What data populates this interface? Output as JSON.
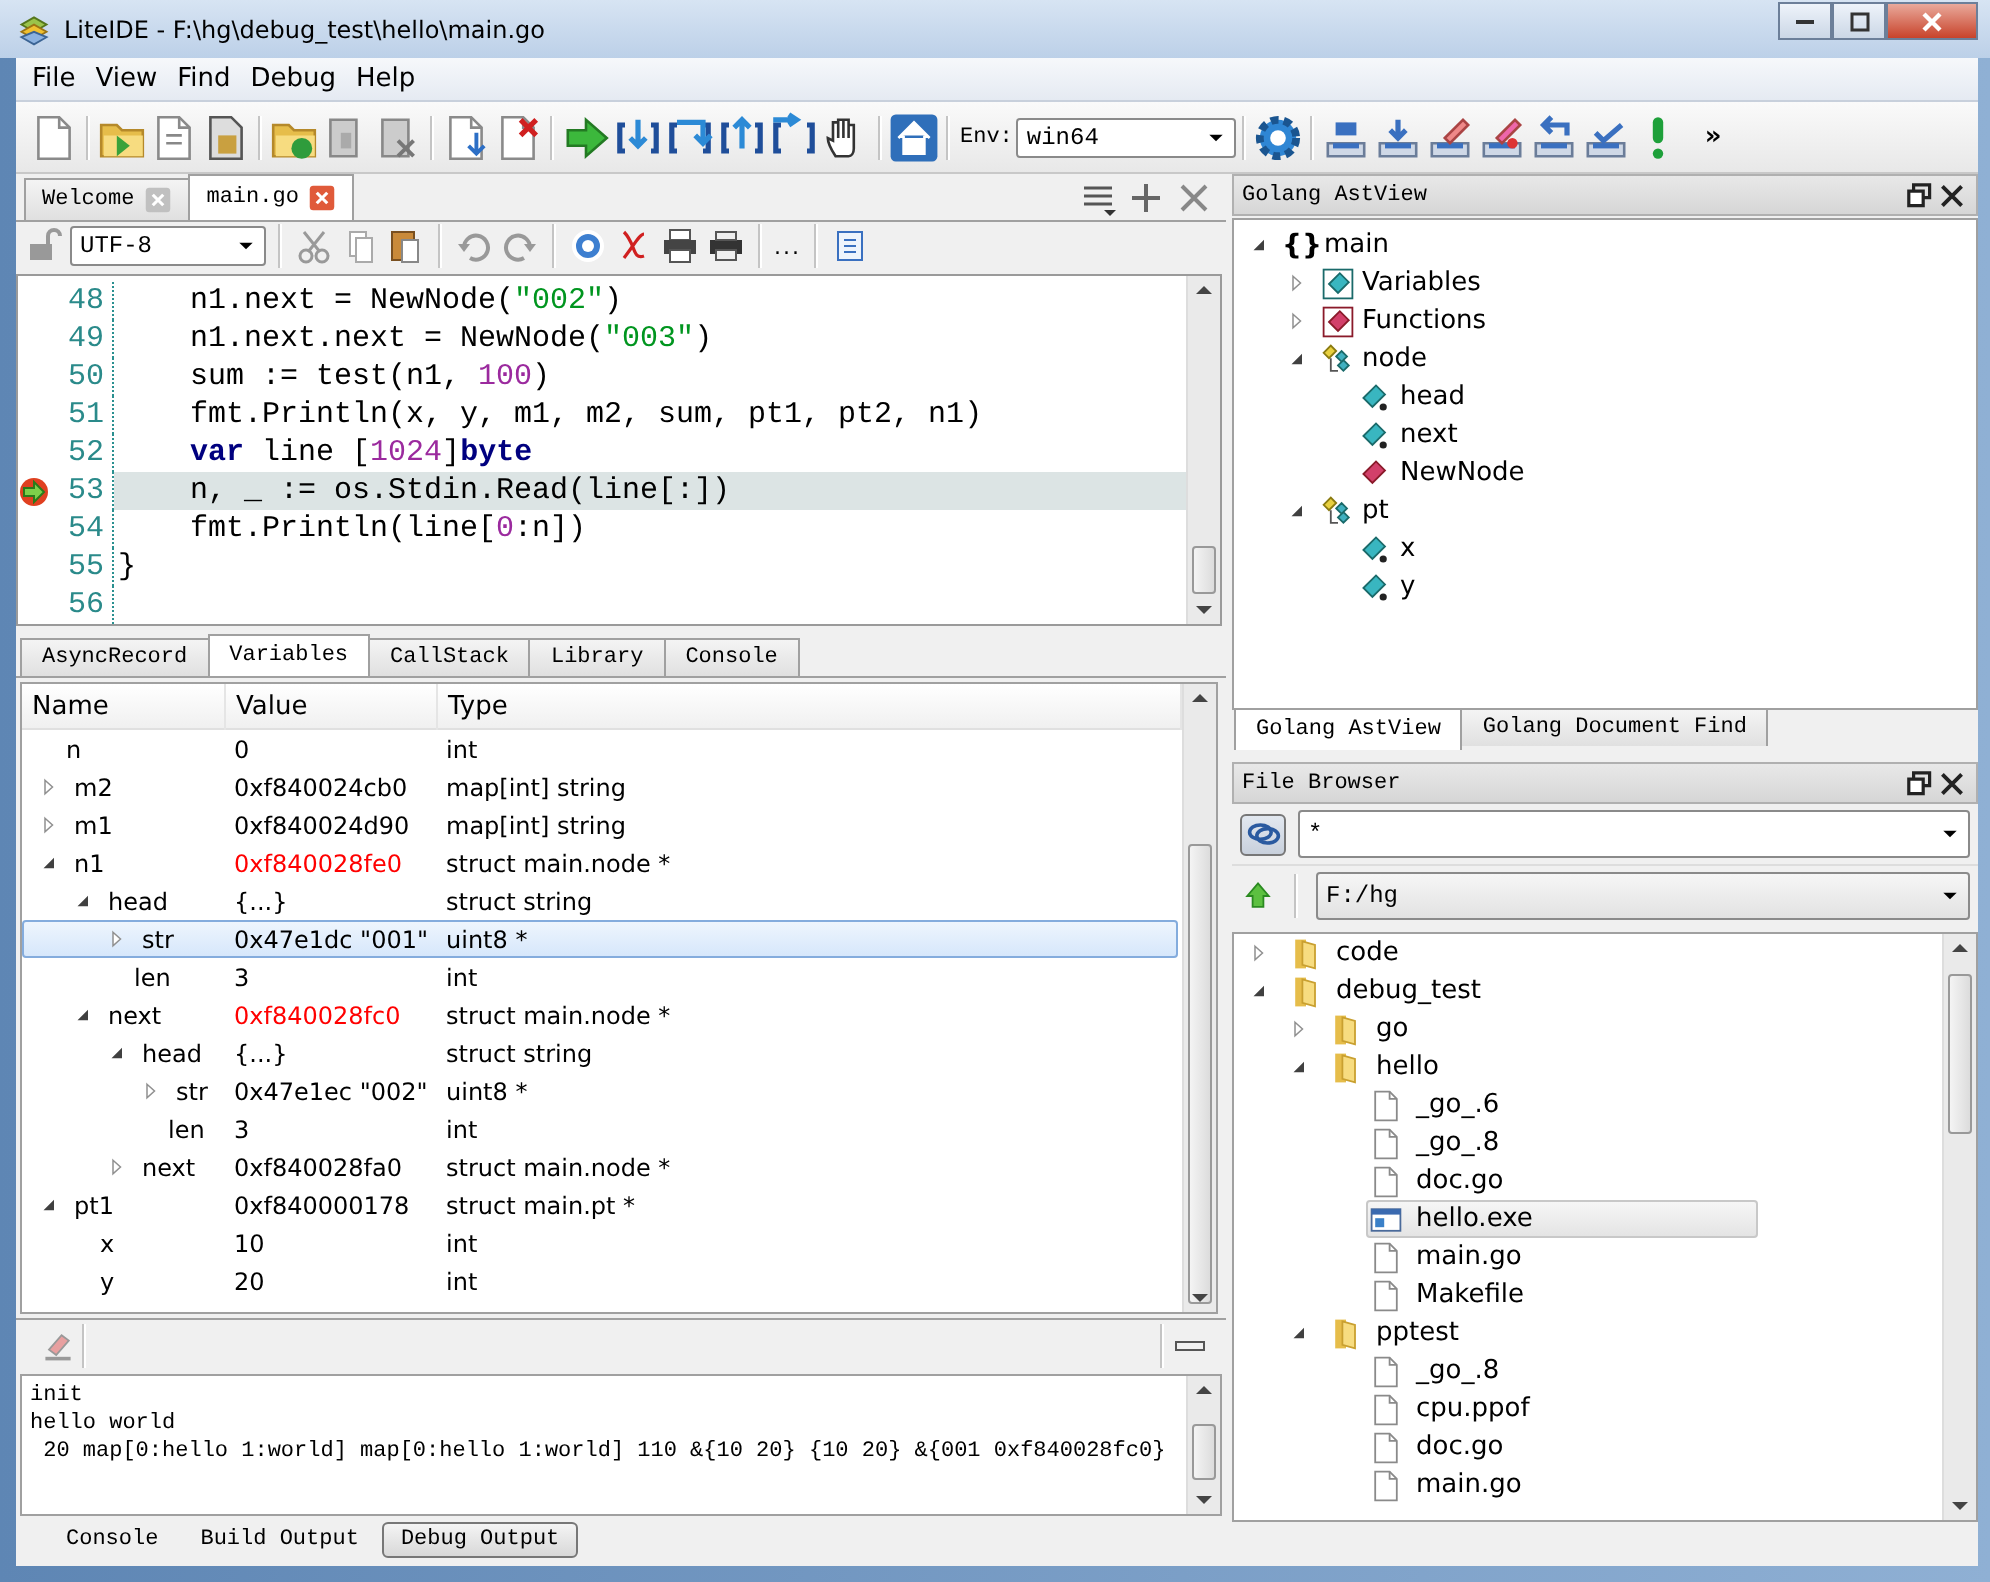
{
  "window": {
    "title": "LiteIDE - F:\\hg\\debug_test\\hello\\main.go"
  },
  "menu": [
    "File",
    "View",
    "Find",
    "Debug",
    "Help"
  ],
  "toolbar": {
    "env_label": "Env:",
    "env_value": "win64",
    "overflow": "»"
  },
  "editor": {
    "tabs": [
      {
        "label": "Welcome",
        "selected": false
      },
      {
        "label": "main.go",
        "selected": true
      }
    ],
    "encoding": "UTF-8",
    "more": "...",
    "lines": [
      {
        "number": "48",
        "current": false,
        "indented": true,
        "tokens": [
          {
            "kind": "plain",
            "text": "n1.next = NewNode("
          },
          {
            "kind": "string",
            "text": "\"002\""
          },
          {
            "kind": "plain",
            "text": ")"
          }
        ]
      },
      {
        "number": "49",
        "current": false,
        "indented": true,
        "tokens": [
          {
            "kind": "plain",
            "text": "n1.next.next = NewNode("
          },
          {
            "kind": "string",
            "text": "\"003\""
          },
          {
            "kind": "plain",
            "text": ")"
          }
        ]
      },
      {
        "number": "50",
        "current": false,
        "indented": true,
        "tokens": [
          {
            "kind": "plain",
            "text": "sum := test(n1, "
          },
          {
            "kind": "number",
            "text": "100"
          },
          {
            "kind": "plain",
            "text": ")"
          }
        ]
      },
      {
        "number": "51",
        "current": false,
        "indented": true,
        "tokens": [
          {
            "kind": "plain",
            "text": "fmt.Println(x, y, m1, m2, sum, pt1, pt2, n1)"
          }
        ]
      },
      {
        "number": "52",
        "current": false,
        "indented": true,
        "tokens": [
          {
            "kind": "keyword",
            "text": "var"
          },
          {
            "kind": "plain",
            "text": " line ["
          },
          {
            "kind": "number",
            "text": "1024"
          },
          {
            "kind": "plain",
            "text": "]"
          },
          {
            "kind": "keyword",
            "text": "byte"
          }
        ]
      },
      {
        "number": "53",
        "current": true,
        "indented": true,
        "tokens": [
          {
            "kind": "plain",
            "text": "n, _ := os.Stdin.Read(line[:])"
          }
        ]
      },
      {
        "number": "54",
        "current": false,
        "indented": true,
        "tokens": [
          {
            "kind": "plain",
            "text": "fmt.Println(line["
          },
          {
            "kind": "number",
            "text": "0"
          },
          {
            "kind": "plain",
            "text": ":n])"
          }
        ]
      },
      {
        "number": "55",
        "current": false,
        "indented": false,
        "tokens": [
          {
            "kind": "plain",
            "text": "}"
          }
        ]
      },
      {
        "number": "56",
        "current": false
      }
    ]
  },
  "debug": {
    "tabs": [
      {
        "label": "AsyncRecord",
        "selected": false
      },
      {
        "label": "Variables",
        "selected": true
      },
      {
        "label": "CallStack",
        "selected": false
      },
      {
        "label": "Library",
        "selected": false
      },
      {
        "label": "Console",
        "selected": false
      }
    ],
    "columns": [
      "Name",
      "Value",
      "Type"
    ],
    "rows": [
      {
        "name": "n",
        "value": "0",
        "type": "int",
        "changed": false,
        "selected": false
      },
      {
        "name": "m2",
        "value": "0xf840024cb0",
        "type": "map[int] string",
        "changed": false,
        "selected": false,
        "expanded": false
      },
      {
        "name": "m1",
        "value": "0xf840024d90",
        "type": "map[int] string",
        "changed": false,
        "selected": false,
        "expanded": false
      },
      {
        "name": "n1",
        "value": "0xf840028fe0",
        "type": "struct main.node *",
        "changed": true,
        "selected": false,
        "expanded": true,
        "children": [
          {
            "name": "head",
            "value": "{...}",
            "type": "struct string",
            "changed": false,
            "selected": false,
            "expanded": true,
            "children": [
              {
                "name": "str",
                "value": "0x47e1dc \"001\"",
                "type": "uint8 *",
                "changed": false,
                "selected": true,
                "expanded": false
              },
              {
                "name": "len",
                "value": "3",
                "type": "int",
                "changed": false,
                "selected": false
              }
            ]
          },
          {
            "name": "next",
            "value": "0xf840028fc0",
            "type": "struct main.node *",
            "changed": true,
            "selected": false,
            "expanded": true,
            "children": [
              {
                "name": "head",
                "value": "{...}",
                "type": "struct string",
                "changed": false,
                "selected": false,
                "expanded": true,
                "children": [
                  {
                    "name": "str",
                    "value": "0x47e1ec \"002\"",
                    "type": "uint8 *",
                    "changed": false,
                    "selected": false,
                    "expanded": false
                  },
                  {
                    "name": "len",
                    "value": "3",
                    "type": "int",
                    "changed": false,
                    "selected": false
                  }
                ]
              },
              {
                "name": "next",
                "value": "0xf840028fa0",
                "type": "struct main.node *",
                "changed": false,
                "selected": false,
                "expanded": false
              }
            ]
          }
        ]
      },
      {
        "name": "pt1",
        "value": "0xf840000178",
        "type": "struct main.pt *",
        "changed": false,
        "selected": false,
        "expanded": true,
        "children": [
          {
            "name": "x",
            "value": "10",
            "type": "int",
            "changed": false,
            "selected": false
          },
          {
            "name": "y",
            "value": "20",
            "type": "int",
            "changed": false,
            "selected": false
          }
        ]
      }
    ]
  },
  "output": {
    "lines": [
      "init",
      "hello world",
      " 20 map[0:hello 1:world] map[0:hello 1:world] 110 &{10 20} {10 20} &{001 0xf840028fc0}"
    ],
    "tabs": [
      {
        "label": "Console",
        "selected": false
      },
      {
        "label": "Build Output",
        "selected": false
      },
      {
        "label": "Debug Output",
        "selected": true
      }
    ]
  },
  "astview": {
    "title": "Golang AstView",
    "tree": [
      {
        "label": "main",
        "kind": "package",
        "icon": "{}",
        "expanded": true,
        "children": [
          {
            "label": "Variables",
            "kind": "vars",
            "expanded": false
          },
          {
            "label": "Functions",
            "kind": "funcs",
            "expanded": false
          },
          {
            "label": "node",
            "kind": "type",
            "expanded": true,
            "children": [
              {
                "label": "head",
                "kind": "field"
              },
              {
                "label": "next",
                "kind": "field"
              },
              {
                "label": "NewNode",
                "kind": "method"
              }
            ]
          },
          {
            "label": "pt",
            "kind": "type",
            "expanded": true,
            "children": [
              {
                "label": "x",
                "kind": "field"
              },
              {
                "label": "y",
                "kind": "field"
              }
            ]
          }
        ]
      }
    ],
    "tabs": [
      {
        "label": "Golang AstView",
        "selected": true
      },
      {
        "label": "Golang Document Find",
        "selected": false
      }
    ]
  },
  "files": {
    "title": "File Browser",
    "filter": "*",
    "path": "F:/hg",
    "tree": [
      {
        "label": "code",
        "kind": "folder",
        "expanded": false,
        "selected": false
      },
      {
        "label": "debug_test",
        "kind": "folder",
        "expanded": true,
        "selected": false,
        "children": [
          {
            "label": "go",
            "kind": "folder",
            "expanded": false,
            "selected": false
          },
          {
            "label": "hello",
            "kind": "folder",
            "expanded": true,
            "selected": false,
            "children": [
              {
                "label": "_go_.6",
                "kind": "file",
                "selected": false
              },
              {
                "label": "_go_.8",
                "kind": "file",
                "selected": false
              },
              {
                "label": "doc.go",
                "kind": "file",
                "selected": false
              },
              {
                "label": "hello.exe",
                "kind": "program",
                "selected": true
              },
              {
                "label": "main.go",
                "kind": "file",
                "selected": false
              },
              {
                "label": "Makefile",
                "kind": "file",
                "selected": false
              }
            ]
          },
          {
            "label": "pptest",
            "kind": "folder",
            "expanded": true,
            "selected": false,
            "children": [
              {
                "label": "_go_.8",
                "kind": "file",
                "selected": false
              },
              {
                "label": "cpu.ppof",
                "kind": "file",
                "selected": false
              },
              {
                "label": "doc.go",
                "kind": "file",
                "selected": false
              },
              {
                "label": "main.go",
                "kind": "file",
                "selected": false
              }
            ]
          }
        ]
      }
    ]
  }
}
